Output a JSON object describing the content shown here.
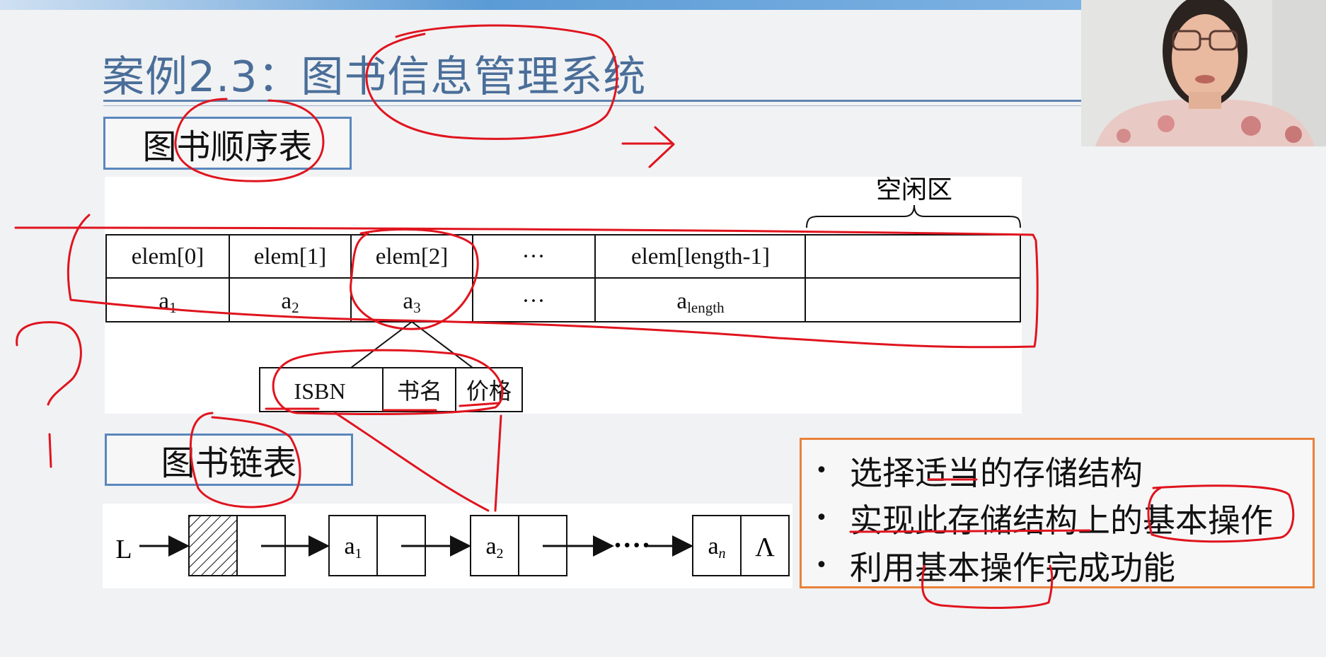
{
  "slide": {
    "title": "案例2.3：图书信息管理系统"
  },
  "sequential": {
    "label": "图书顺序表",
    "free_label": "空闲区",
    "headers": [
      "elem[0]",
      "elem[1]",
      "elem[2]",
      "···",
      "elem[length-1]",
      ""
    ],
    "values": [
      {
        "base": "a",
        "sub": "1"
      },
      {
        "base": "a",
        "sub": "2"
      },
      {
        "base": "a",
        "sub": "3"
      },
      {
        "base": "···",
        "sub": ""
      },
      {
        "base": "a",
        "sub": "length"
      },
      {
        "base": "",
        "sub": ""
      }
    ],
    "record_fields": [
      "ISBN",
      "书名",
      "价格"
    ]
  },
  "linked": {
    "label": "图书链表",
    "head": "L",
    "nodes": [
      {
        "base": "a",
        "sub": "1"
      },
      {
        "base": "a",
        "sub": "2"
      },
      {
        "base": "a",
        "sub": "n"
      }
    ],
    "ellipsis": "····",
    "null_symbol": "Λ"
  },
  "bullets": [
    "选择适当的存储结构",
    "实现此存储结构上的基本操作",
    "利用基本操作完成功能"
  ],
  "colors": {
    "title": "#4a6e99",
    "label_border": "#5a87bd",
    "bullet_border": "#e8823a",
    "annotation": "#e0141e"
  }
}
